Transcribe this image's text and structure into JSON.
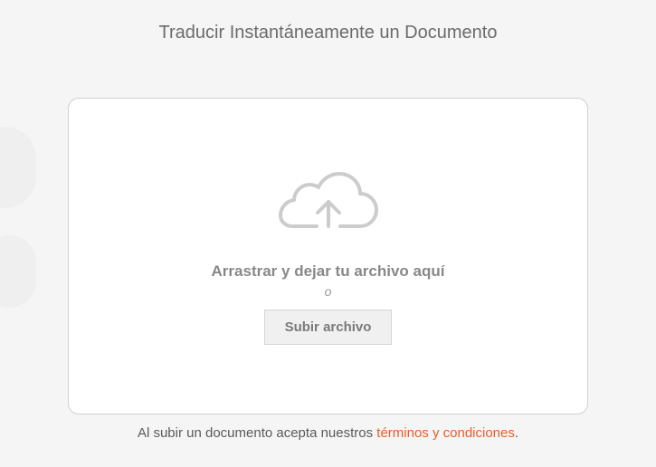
{
  "header": {
    "title": "Traducir Instantáneamente un Documento"
  },
  "upload": {
    "drag_text": "Arrastrar y dejar tu archivo aquí",
    "or_text": "o",
    "button_label": "Subir archivo"
  },
  "footer": {
    "terms_prefix": "Al subir un documento acepta nuestros ",
    "terms_link": "términos y condiciones",
    "terms_suffix": "."
  }
}
